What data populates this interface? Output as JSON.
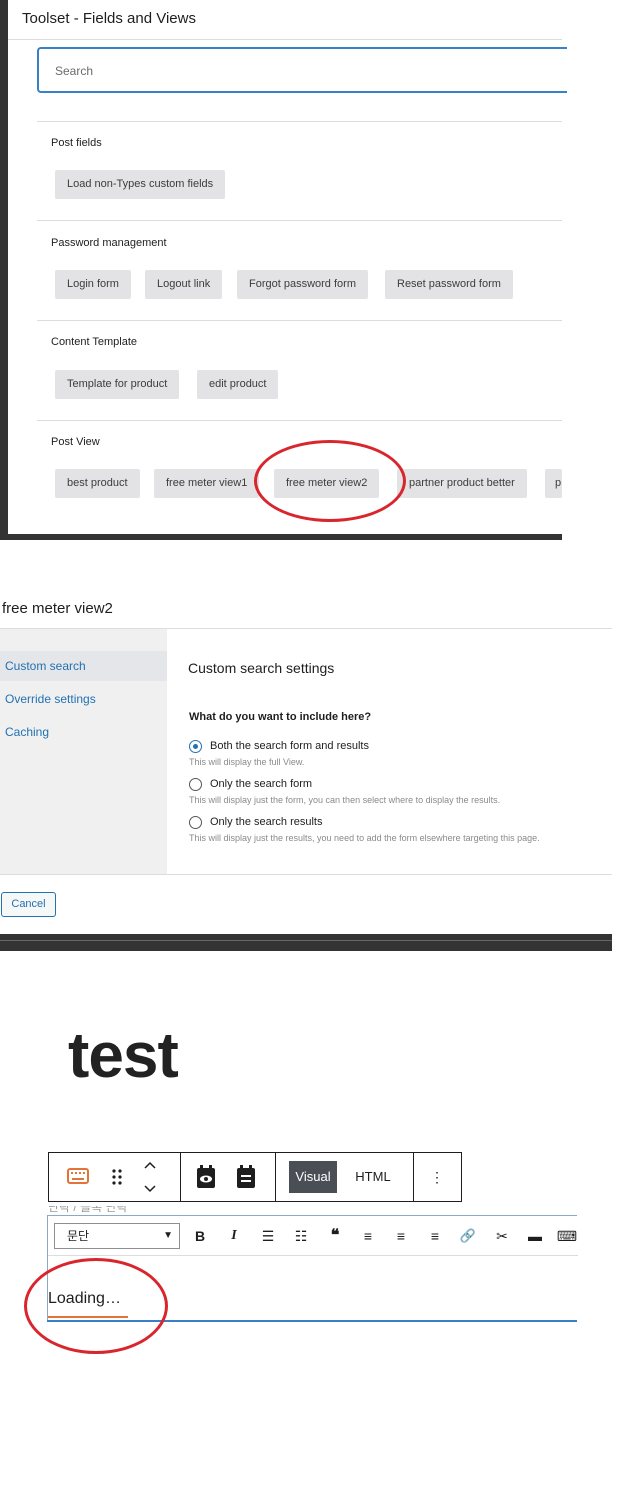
{
  "panel1": {
    "title": "Toolset - Fields and Views",
    "search_placeholder": "Search",
    "sections": [
      {
        "title": "Post fields",
        "chips": [
          "Load non-Types custom fields"
        ]
      },
      {
        "title": "Password management",
        "chips": [
          "Login form",
          "Logout link",
          "Forgot password form",
          "Reset password form"
        ]
      },
      {
        "title": "Content Template",
        "chips": [
          "Template for product",
          "edit product"
        ]
      },
      {
        "title": "Post View",
        "chips": [
          "best product",
          "free meter view1",
          "free meter view2",
          "partner product better",
          "p"
        ]
      }
    ]
  },
  "panel2": {
    "title": "free meter view2",
    "sidebar": [
      "Custom search",
      "Override settings",
      "Caching"
    ],
    "heading": "Custom search settings",
    "question": "What do you want to include here?",
    "options": [
      {
        "label": "Both the search form and results",
        "desc": "This will display the full View.",
        "checked": true
      },
      {
        "label": "Only the search form",
        "desc": "This will display just the form, you can then select where to display the results.",
        "checked": false
      },
      {
        "label": "Only the search results",
        "desc": "This will display just the results, you need to add the form elsewhere targeting this page.",
        "checked": false
      }
    ],
    "cancel": "Cancel"
  },
  "panel3": {
    "page_title": "test",
    "toolbar": {
      "visual": "Visual",
      "html": "HTML",
      "more": "⋮"
    },
    "faint_text": "단락 / 블록 단락",
    "format_select": "문단",
    "editor_buttons": [
      "B",
      "I",
      "☰",
      "☷",
      "❝",
      "≡",
      "≡",
      "≡",
      "🔗",
      "✂",
      "▬",
      "⌨"
    ],
    "loading": "Loading…"
  },
  "colors": {
    "accent": "#2271b1",
    "highlight_circle": "#d9262c",
    "loading_underline": "#e2733a"
  }
}
